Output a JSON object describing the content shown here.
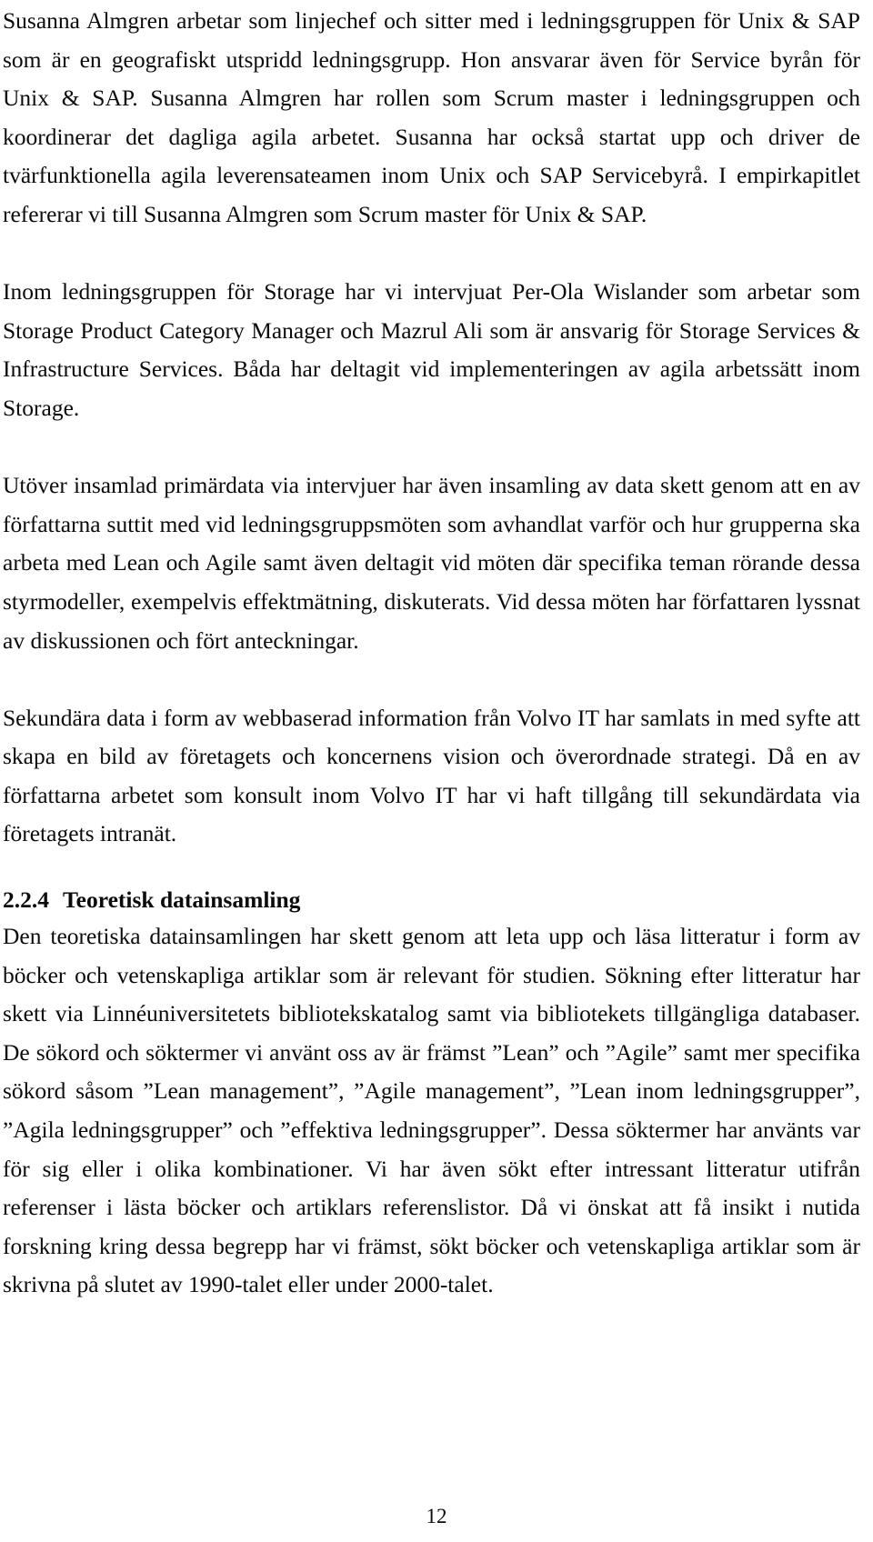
{
  "document": {
    "language": "sv",
    "page_number": "12",
    "body_paragraphs": [
      "Susanna Almgren arbetar som linjechef och sitter med i ledningsgruppen för Unix & SAP som är en geografiskt utspridd ledningsgrupp. Hon ansvarar även för Service byrån för Unix & SAP. Susanna Almgren har rollen som Scrum master i ledningsgruppen och koordinerar det dagliga agila arbetet. Susanna har också startat upp och driver de tvärfunktionella agila leverensateamen inom Unix och SAP Servicebyrå. I empirkapitlet refererar vi till Susanna Almgren som Scrum master för Unix & SAP.",
      "Inom ledningsgruppen för Storage har vi intervjuat Per-Ola Wislander som arbetar som Storage Product Category Manager och Mazrul Ali som är ansvarig för Storage Services & Infrastructure Services. Båda har deltagit vid implementeringen av agila arbetssätt inom Storage.",
      "Utöver insamlad primärdata via intervjuer har även insamling av data skett genom att en av författarna suttit med vid ledningsgruppsmöten som avhandlat varför och hur grupperna ska arbeta med Lean och Agile samt även deltagit vid möten där specifika teman rörande dessa styrmodeller, exempelvis effektmätning, diskuterats. Vid dessa möten har författaren lyssnat av diskussionen och fört anteckningar.",
      "Sekundära data i form av webbaserad information från Volvo IT har samlats in med syfte att skapa en bild av företagets och koncernens vision och överordnade strategi. Då en av författarna arbetet som konsult inom Volvo IT har vi haft tillgång till sekundärdata via företagets intranät."
    ],
    "section": {
      "number": "2.2.4",
      "title": "Teoretisk datainsamling",
      "paragraph": "Den teoretiska datainsamlingen har skett genom att leta upp och läsa litteratur i form av böcker och vetenskapliga artiklar som är relevant för studien. Sökning efter litteratur har skett via Linnéuniversitetets bibliotekskatalog samt via bibliotekets tillgängliga databaser. De sökord och söktermer vi använt oss av är främst ”Lean” och ”Agile” samt mer specifika sökord såsom ”Lean management”, ”Agile management”, ”Lean inom ledningsgrupper”, ”Agila ledningsgrupper” och ”effektiva ledningsgrupper”. Dessa söktermer har använts var för sig eller i olika kombinationer. Vi har även sökt efter intressant litteratur utifrån referenser i lästa böcker och artiklars referenslistor. Då vi önskat att få insikt i nutida forskning kring dessa begrepp har vi främst, sökt böcker och vetenskapliga artiklar som är skrivna på slutet av 1990-talet eller under 2000-talet."
    }
  }
}
